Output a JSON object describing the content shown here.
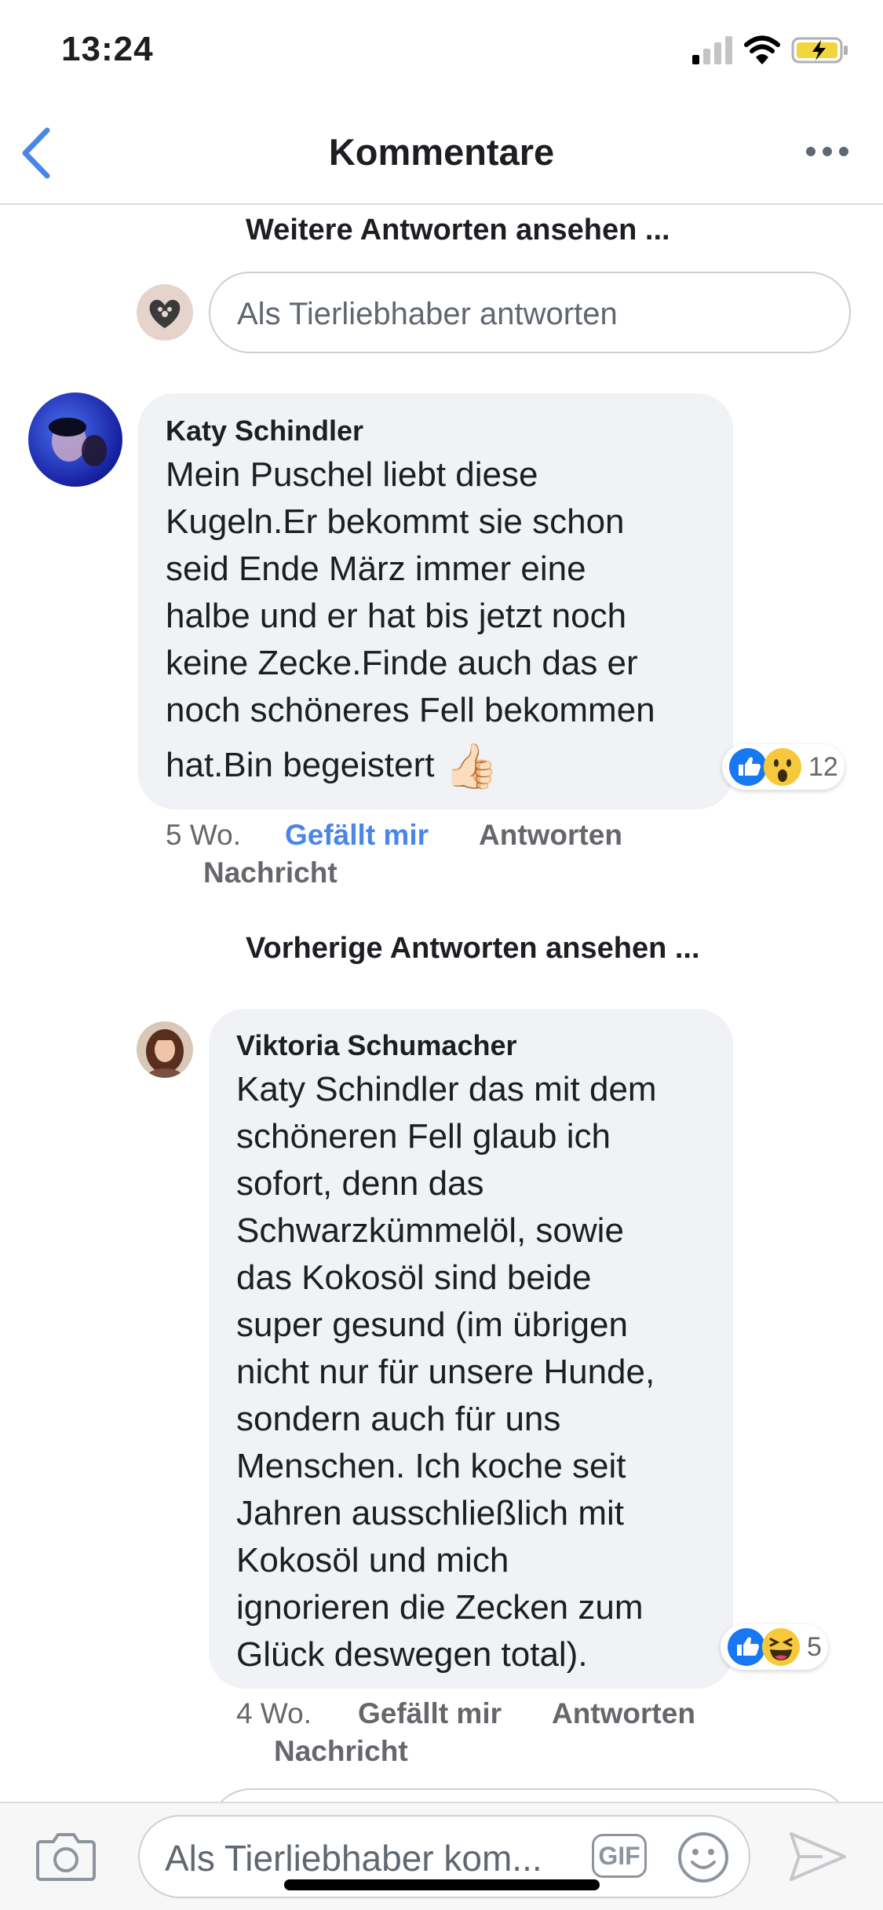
{
  "status_bar": {
    "time": "13:24"
  },
  "nav": {
    "title": "Kommentare"
  },
  "more_replies_link": "Weitere Antworten ansehen ...",
  "reply_box": {
    "placeholder": "Als Tierliebhaber antworten"
  },
  "comments": [
    {
      "author": "Katy Schindler",
      "text_lines": [
        "Mein Puschel liebt diese",
        "Kugeln.Er bekommt sie schon",
        "seid Ende März immer eine",
        "halbe und er hat bis jetzt noch",
        "keine Zecke.Finde auch das er",
        "noch schöneres Fell bekommen",
        "hat.Bin begeistert"
      ],
      "emoji": "👍🏻",
      "reaction_count": "12",
      "reactions": [
        "like",
        "wow"
      ],
      "time": "5 Wo.",
      "like_label": "Gefällt mir",
      "reply_label": "Antworten",
      "message_label": "Nachricht"
    },
    {
      "author": "Viktoria Schumacher",
      "text_lines": [
        "Katy Schindler das mit dem",
        "schöneren Fell glaub ich",
        "sofort, denn das",
        "Schwarzkümmelöl, sowie",
        "das Kokosöl sind beide",
        "super gesund (im übrigen",
        "nicht nur für unsere Hunde,",
        "sondern auch für uns",
        "Menschen. Ich koche seit",
        "Jahren ausschließlich mit",
        "Kokosöl und mich",
        "ignorieren die Zecken zum",
        "Glück deswegen total)."
      ],
      "reaction_count": "5",
      "reactions": [
        "like",
        "haha"
      ],
      "time": "4 Wo.",
      "like_label": "Gefällt mir",
      "reply_label": "Antworten",
      "message_label": "Nachricht"
    }
  ],
  "previous_replies_link": "Vorherige Antworten ansehen ...",
  "comment_bar": {
    "placeholder": "Als Tierliebhaber kom...",
    "gif_label": "GIF"
  },
  "colors": {
    "accent": "#4a86e8",
    "bubble": "#f0f2f5",
    "like_blue": "#1877f2"
  }
}
